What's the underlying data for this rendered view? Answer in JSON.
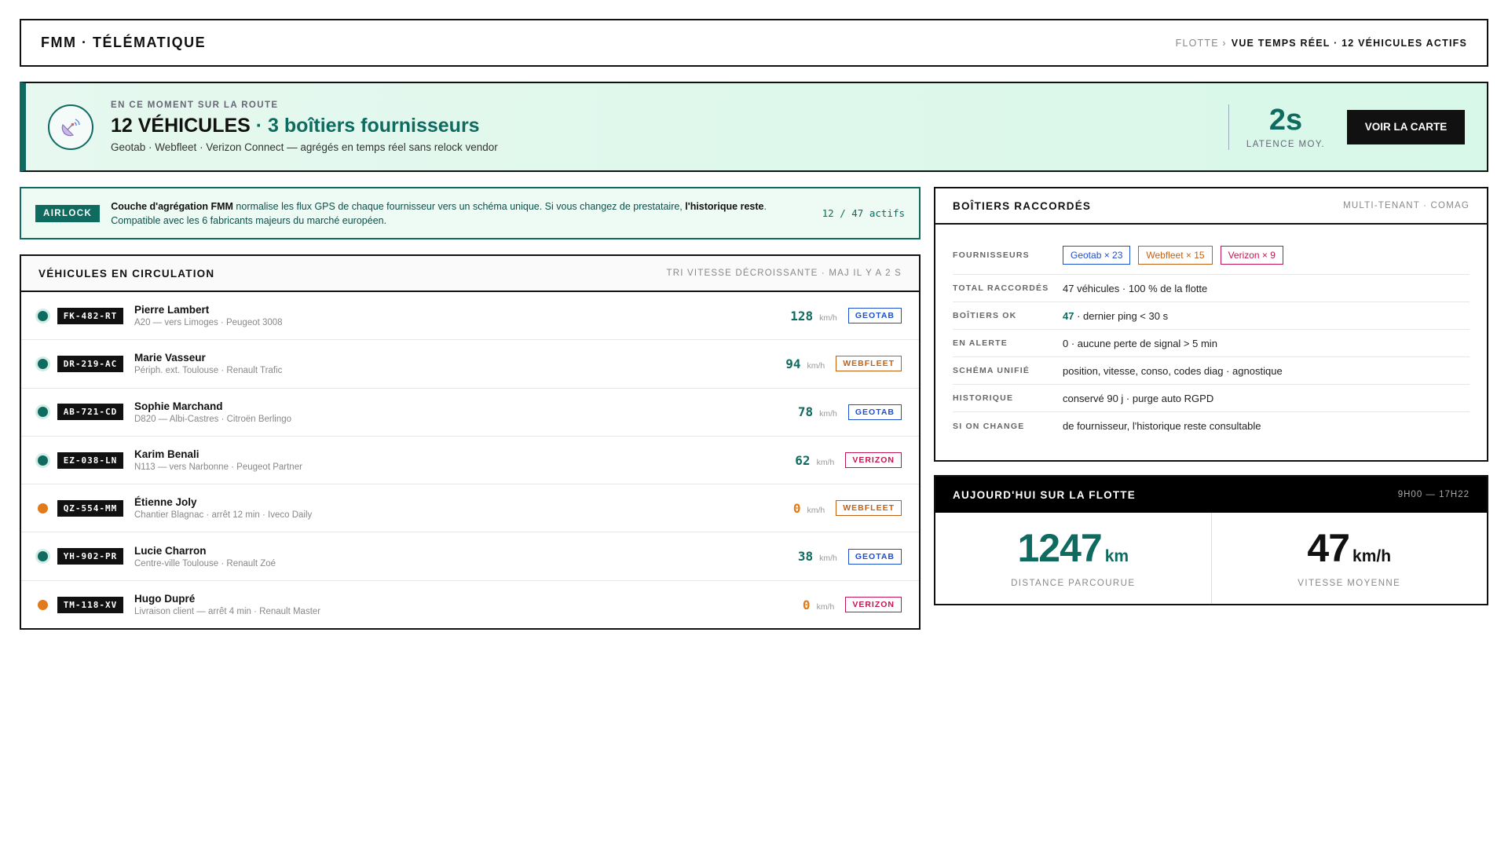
{
  "header": {
    "brand": "FMM · TÉLÉMATIQUE",
    "crumb_root": "FLOTTE ›",
    "crumb_current": "VUE TEMPS RÉEL · 12 VÉHICULES ACTIFS"
  },
  "hero": {
    "icon": "satellite-dish-icon",
    "eyebrow": "EN CE MOMENT SUR LA ROUTE",
    "title_main": "12 VÉHICULES",
    "title_accent": " · 3 boîtiers fournisseurs",
    "subtitle": "Geotab · Webfleet · Verizon Connect — agrégés en temps réel sans relock vendor",
    "latency_value": "2s",
    "latency_label": "LATENCE MOY.",
    "map_button": "VOIR LA CARTE"
  },
  "airlock": {
    "badge": "AIRLOCK",
    "lead_bold": "Couche d'agrégation FMM",
    "text_1": " normalise les flux GPS de chaque fournisseur vers un schéma unique. Si vous changez de prestataire, ",
    "text_bold_2": "l'historique reste",
    "text_2": ".",
    "line_2": "Compatible avec les 6 fabricants majeurs du marché européen.",
    "count": "12 / 47 actifs"
  },
  "vehicles": {
    "title": "VÉHICULES EN CIRCULATION",
    "meta": "TRI VITESSE DÉCROISSANTE · MAJ IL Y A 2 S",
    "unit": "km/h",
    "rows": [
      {
        "plate": "FK-482-RT",
        "name": "Pierre Lambert",
        "desc": "A20 — vers Limoges · Peugeot 3008",
        "speed": "128",
        "tag": "GEOTAB",
        "provider": "geotab",
        "state": "ok"
      },
      {
        "plate": "DR-219-AC",
        "name": "Marie Vasseur",
        "desc": "Périph. ext. Toulouse · Renault Trafic",
        "speed": "94",
        "tag": "WEBFLEET",
        "provider": "webfleet",
        "state": "ok"
      },
      {
        "plate": "AB-721-CD",
        "name": "Sophie Marchand",
        "desc": "D820 — Albi-Castres · Citroën Berlingo",
        "speed": "78",
        "tag": "GEOTAB",
        "provider": "geotab",
        "state": "ok"
      },
      {
        "plate": "EZ-038-LN",
        "name": "Karim Benali",
        "desc": "N113 — vers Narbonne · Peugeot Partner",
        "speed": "62",
        "tag": "VERIZON",
        "provider": "verizon",
        "state": "ok"
      },
      {
        "plate": "QZ-554-MM",
        "name": "Étienne Joly",
        "desc": "Chantier Blagnac · arrêt 12 min · Iveco Daily",
        "speed": "0",
        "tag": "WEBFLEET",
        "provider": "webfleet",
        "state": "stop"
      },
      {
        "plate": "YH-902-PR",
        "name": "Lucie Charron",
        "desc": "Centre-ville Toulouse · Renault Zoé",
        "speed": "38",
        "tag": "GEOTAB",
        "provider": "geotab",
        "state": "ok"
      },
      {
        "plate": "TM-118-XV",
        "name": "Hugo Dupré",
        "desc": "Livraison client — arrêt 4 min · Renault Master",
        "speed": "0",
        "tag": "VERIZON",
        "provider": "verizon",
        "state": "stop"
      }
    ]
  },
  "boitiers": {
    "title": "BOÎTIERS RACCORDÉS",
    "meta": "MULTI-TENANT · COMAG",
    "providers_label": "FOURNISSEURS",
    "chips": [
      {
        "label": "Geotab × 23",
        "provider": "geotab"
      },
      {
        "label": "Webfleet × 15",
        "provider": "webfleet"
      },
      {
        "label": "Verizon × 9",
        "provider": "verizon"
      }
    ],
    "total_label": "TOTAL RACCORDÉS",
    "total_value": "47 véhicules · 100 % de la flotte",
    "ok_label": "BOÎTIERS OK",
    "ok_highlight": "47",
    "ok_rest": " · dernier ping < 30 s",
    "alert_label": "EN ALERTE",
    "alert_value": "0 · aucune perte de signal > 5 min",
    "schema_label": "SCHÉMA UNIFIÉ",
    "schema_value": "position, vitesse, conso, codes diag · agnostique",
    "history_label": "HISTORIQUE",
    "history_value": "conservé 90 j · purge auto RGPD",
    "change_label": "SI ON CHANGE",
    "change_value": "de fournisseur, l'historique reste consultable"
  },
  "today": {
    "title": "AUJOURD'HUI SUR LA FLOTTE",
    "meta": "9H00 — 17H22",
    "distance_value": "1247",
    "distance_unit": "km",
    "distance_label": "DISTANCE PARCOURUE",
    "speed_value": "47",
    "speed_unit": "km/h",
    "speed_label": "VITESSE MOYENNE"
  },
  "colors": {
    "accent": "#0f6b60",
    "stop": "#e07a1a",
    "geotab": "#1d4fd1",
    "webfleet": "#c26116",
    "verizon": "#c3164f"
  }
}
